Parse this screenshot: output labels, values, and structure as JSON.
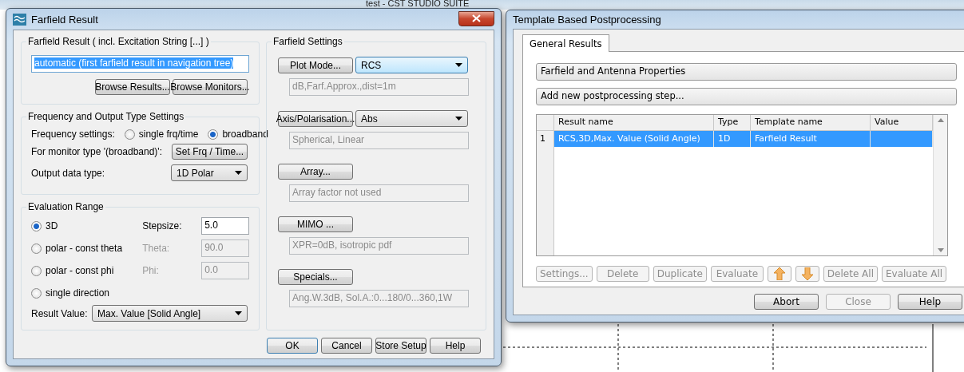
{
  "background_window": {
    "title": "test - CST STUDIO SUITE"
  },
  "farfield_dialog": {
    "title": "Farfield Result",
    "result_group": {
      "legend": "Farfield Result ( incl. Excitation String [...] )",
      "field_value": "automatic (first farfield result in navigation tree)",
      "buttons": [
        "Browse Results...",
        "Browse Monitors..."
      ]
    },
    "frequency_group": {
      "legend": "Frequency and Output Type Settings",
      "frequency_label": "Frequency settings:",
      "radios": [
        {
          "label": "single frq/time",
          "selected": false
        },
        {
          "label": "broadband",
          "selected": true
        }
      ],
      "monitor_label": "For monitor type '(broadband)':",
      "monitor_button": "Set Frq / Time...",
      "output_label": "Output data type:",
      "output_select": "1D Polar"
    },
    "evaluation_group": {
      "legend": "Evaluation Range",
      "options": [
        {
          "label": "3D",
          "selected": true
        },
        {
          "label": "polar - const theta",
          "selected": false
        },
        {
          "label": "polar - const phi",
          "selected": false
        },
        {
          "label": "single direction",
          "selected": false
        }
      ],
      "fields": [
        {
          "label": "Stepsize:",
          "value": "5.0",
          "disabled": false
        },
        {
          "label": "Theta:",
          "value": "90.0",
          "disabled": true
        },
        {
          "label": "Phi:",
          "value": "0.0",
          "disabled": true
        }
      ],
      "result_label": "Result Value:",
      "result_select": "Max. Value [Solid Angle]"
    },
    "settings_group": {
      "legend": "Farfield Settings",
      "rows": [
        {
          "button": "Plot Mode...",
          "select": "RCS",
          "focused": true,
          "info": "dB,Farf.Approx.,dist=1m"
        },
        {
          "button": "Axis/Polarisation...",
          "select": "Abs",
          "focused": false,
          "info": "Spherical, Linear"
        },
        {
          "button": "Array...",
          "info": "Array factor not used"
        },
        {
          "button": "MIMO ...",
          "info": "XPR=0dB, isotropic pdf"
        },
        {
          "button": "Specials...",
          "info": "Ang.W.3dB, Sol.A.:0...180/0...360,1W"
        }
      ]
    },
    "buttons": [
      {
        "label": "OK",
        "default": true
      },
      {
        "label": "Cancel",
        "default": false
      },
      {
        "label": "Store Setup",
        "default": false
      },
      {
        "label": "Help",
        "default": false
      }
    ]
  },
  "template_dialog": {
    "title": "Template Based Postprocessing",
    "tabs": [
      {
        "label": "General Results",
        "selected": true
      }
    ],
    "category_select": "Farfield and Antenna Properties",
    "step_select": "Add new postprocessing step...",
    "table": {
      "columns": [
        "Result name",
        "Type",
        "Template name",
        "Value"
      ],
      "rows": [
        {
          "number": "1",
          "cells": [
            "RCS,3D,Max. Value (Solid Angle)",
            "1D",
            "Farfield Result",
            ""
          ],
          "selected": true
        }
      ]
    },
    "actions": [
      {
        "kind": "text",
        "label": "Settings...",
        "disabled": true
      },
      {
        "kind": "text",
        "label": "Delete",
        "disabled": true
      },
      {
        "kind": "text",
        "label": "Duplicate",
        "disabled": true
      },
      {
        "kind": "text",
        "label": "Evaluate",
        "disabled": true
      },
      {
        "kind": "up",
        "disabled": true
      },
      {
        "kind": "down",
        "disabled": true
      },
      {
        "kind": "text",
        "label": "Delete All",
        "disabled": true
      },
      {
        "kind": "text",
        "label": "Evaluate All",
        "disabled": true
      }
    ],
    "buttons": [
      {
        "label": "Abort",
        "disabled": false
      },
      {
        "label": "Close",
        "disabled": true
      },
      {
        "label": "Help",
        "disabled": false
      }
    ]
  }
}
